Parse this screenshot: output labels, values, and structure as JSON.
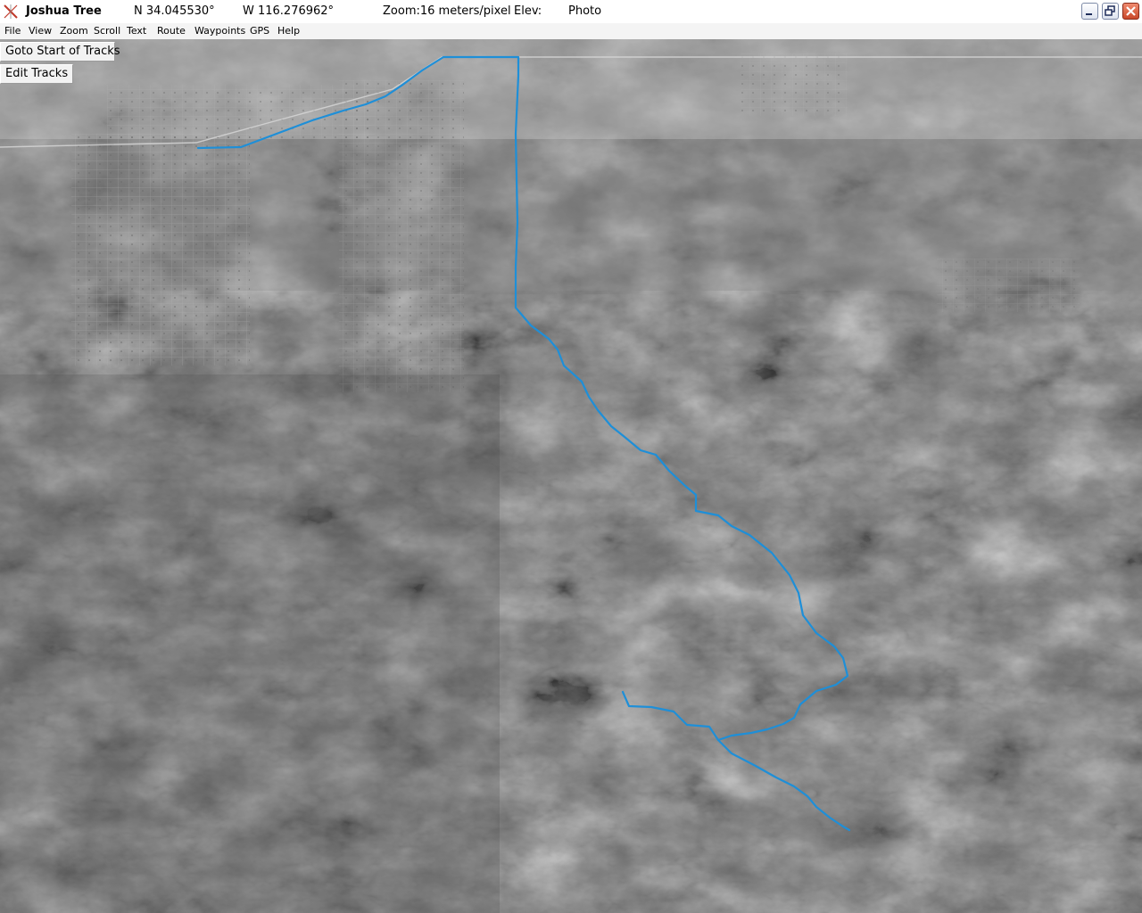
{
  "window": {
    "title": "Joshua Tree",
    "latitude": "N 34.045530°",
    "longitude": "W 116.276962°",
    "zoom": "Zoom:16 meters/pixel",
    "elevation_label": "Elev:",
    "map_type": "Photo"
  },
  "menu": {
    "file": "File",
    "view": "View",
    "zoom": "Zoom",
    "scroll": "Scroll",
    "text": "Text",
    "route": "Route",
    "waypoints": "Waypoints",
    "gps": "GPS",
    "help": "Help"
  },
  "toolbar": {
    "goto_start": "Goto Start of Tracks",
    "edit_tracks": "Edit Tracks"
  },
  "map": {
    "imagery": "grayscale aerial photo",
    "track_color": "#1e8fd8"
  },
  "icons": {
    "app": "app-icon",
    "minimize": "minimize-icon",
    "restore": "restore-icon",
    "close": "close-icon"
  }
}
